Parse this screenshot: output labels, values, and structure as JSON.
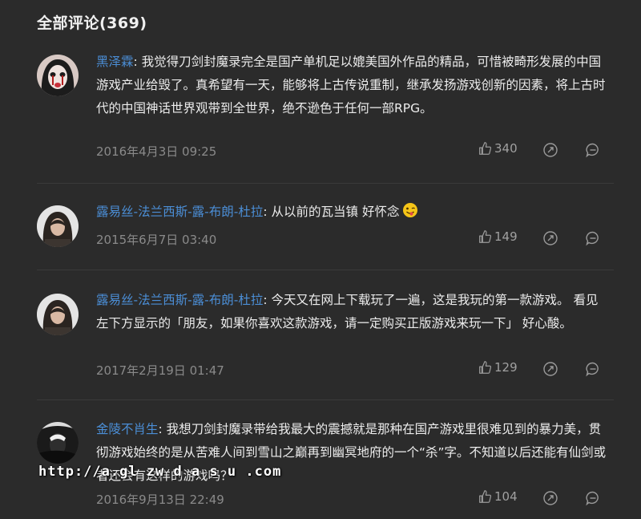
{
  "header": {
    "title": "全部评论(369)"
  },
  "comments": [
    {
      "user": "黑泽霖",
      "content": "我觉得刀剑封魔录完全是国产单机足以媲美国外作品的精品，可惜被畸形发展的中国游戏产业给毁了。真希望有一天，能够将上古传说重制，继承发扬游戏创新的因素，将上古时代的中国神话世界观带到全世界，绝不逊色于任何一部RPG。",
      "date": "2016年4月3日 09:25",
      "likes": "340"
    },
    {
      "user": "露易丝-法兰西斯-露-布朗-杜拉",
      "content": "从以前的瓦当镇 好怀念",
      "emoji": "winking-tongue-emoji",
      "date": "2015年6月7日 03:40",
      "likes": "149"
    },
    {
      "user": "露易丝-法兰西斯-露-布朗-杜拉",
      "content": "今天又在网上下载玩了一遍，这是我玩的第一款游戏。 看见左下方显示的「朋友，如果你喜欢这款游戏，请一定购买正版游戏来玩一下」 好心酸。",
      "date": "2017年2月19日 01:47",
      "likes": "129"
    },
    {
      "user": "金陵不肖生",
      "content": "我想刀剑封魔录带给我最大的震撼就是那种在国产游戏里很难见到的暴力美，贯彻游戏始终的是从苦难人间到雪山之巅再到幽冥地府的一个“杀”字。不知道以后还能有仙剑或者还会有这样的游戏吗？",
      "date": "2016年9月13日 22:49",
      "likes": "104"
    }
  ],
  "separator": ": ",
  "watermark": "http://a.gl zw d a s u .com",
  "colors": {
    "background": "#2b2b2b",
    "username": "#4b8ed6",
    "meta": "#8a8a8a"
  }
}
